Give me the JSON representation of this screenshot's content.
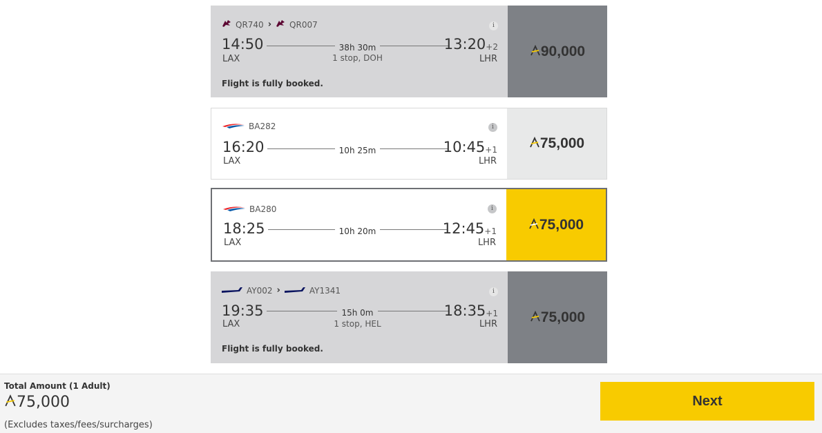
{
  "currency_symbol": "A",
  "flights": [
    {
      "status": "booked",
      "segments": [
        {
          "carrier_icon": "qatar-airways-logo-icon",
          "code": "QR740"
        },
        {
          "carrier_icon": "qatar-airways-logo-icon",
          "code": "QR007"
        }
      ],
      "dep_time": "14:50",
      "dep_airport": "LAX",
      "arr_time": "13:20",
      "arr_offset": "+2",
      "arr_airport": "LHR",
      "duration": "38h 30m",
      "stops": "1 stop, DOH",
      "price": "90,000",
      "message": "Flight is fully booked."
    },
    {
      "status": "normal",
      "segments": [
        {
          "carrier_icon": "british-airways-logo-icon",
          "code": "BA282"
        }
      ],
      "dep_time": "16:20",
      "dep_airport": "LAX",
      "arr_time": "10:45",
      "arr_offset": "+1",
      "arr_airport": "LHR",
      "duration": "10h 25m",
      "price": "75,000"
    },
    {
      "status": "selected",
      "segments": [
        {
          "carrier_icon": "british-airways-logo-icon",
          "code": "BA280"
        }
      ],
      "dep_time": "18:25",
      "dep_airport": "LAX",
      "arr_time": "12:45",
      "arr_offset": "+1",
      "arr_airport": "LHR",
      "duration": "10h 20m",
      "price": "75,000"
    },
    {
      "status": "booked",
      "segments": [
        {
          "carrier_icon": "finnair-logo-icon",
          "code": "AY002"
        },
        {
          "carrier_icon": "finnair-logo-icon",
          "code": "AY1341"
        }
      ],
      "dep_time": "19:35",
      "dep_airport": "LAX",
      "arr_time": "18:35",
      "arr_offset": "+1",
      "arr_airport": "LHR",
      "duration": "15h 0m",
      "stops": "1 stop, HEL",
      "price": "75,000",
      "message": "Flight is fully booked."
    }
  ],
  "footer": {
    "label": "Total Amount (1 Adult)",
    "amount": "75,000",
    "note": "(Excludes taxes/fees/surcharges)",
    "next_label": "Next"
  },
  "colors": {
    "accent_yellow": "#f8cb00",
    "booked_grey": "#7e8186",
    "qatar_maroon": "#5c0632",
    "ba_red": "#eb2226",
    "ba_blue": "#075aaa",
    "finnair_blue": "#0b1560"
  }
}
